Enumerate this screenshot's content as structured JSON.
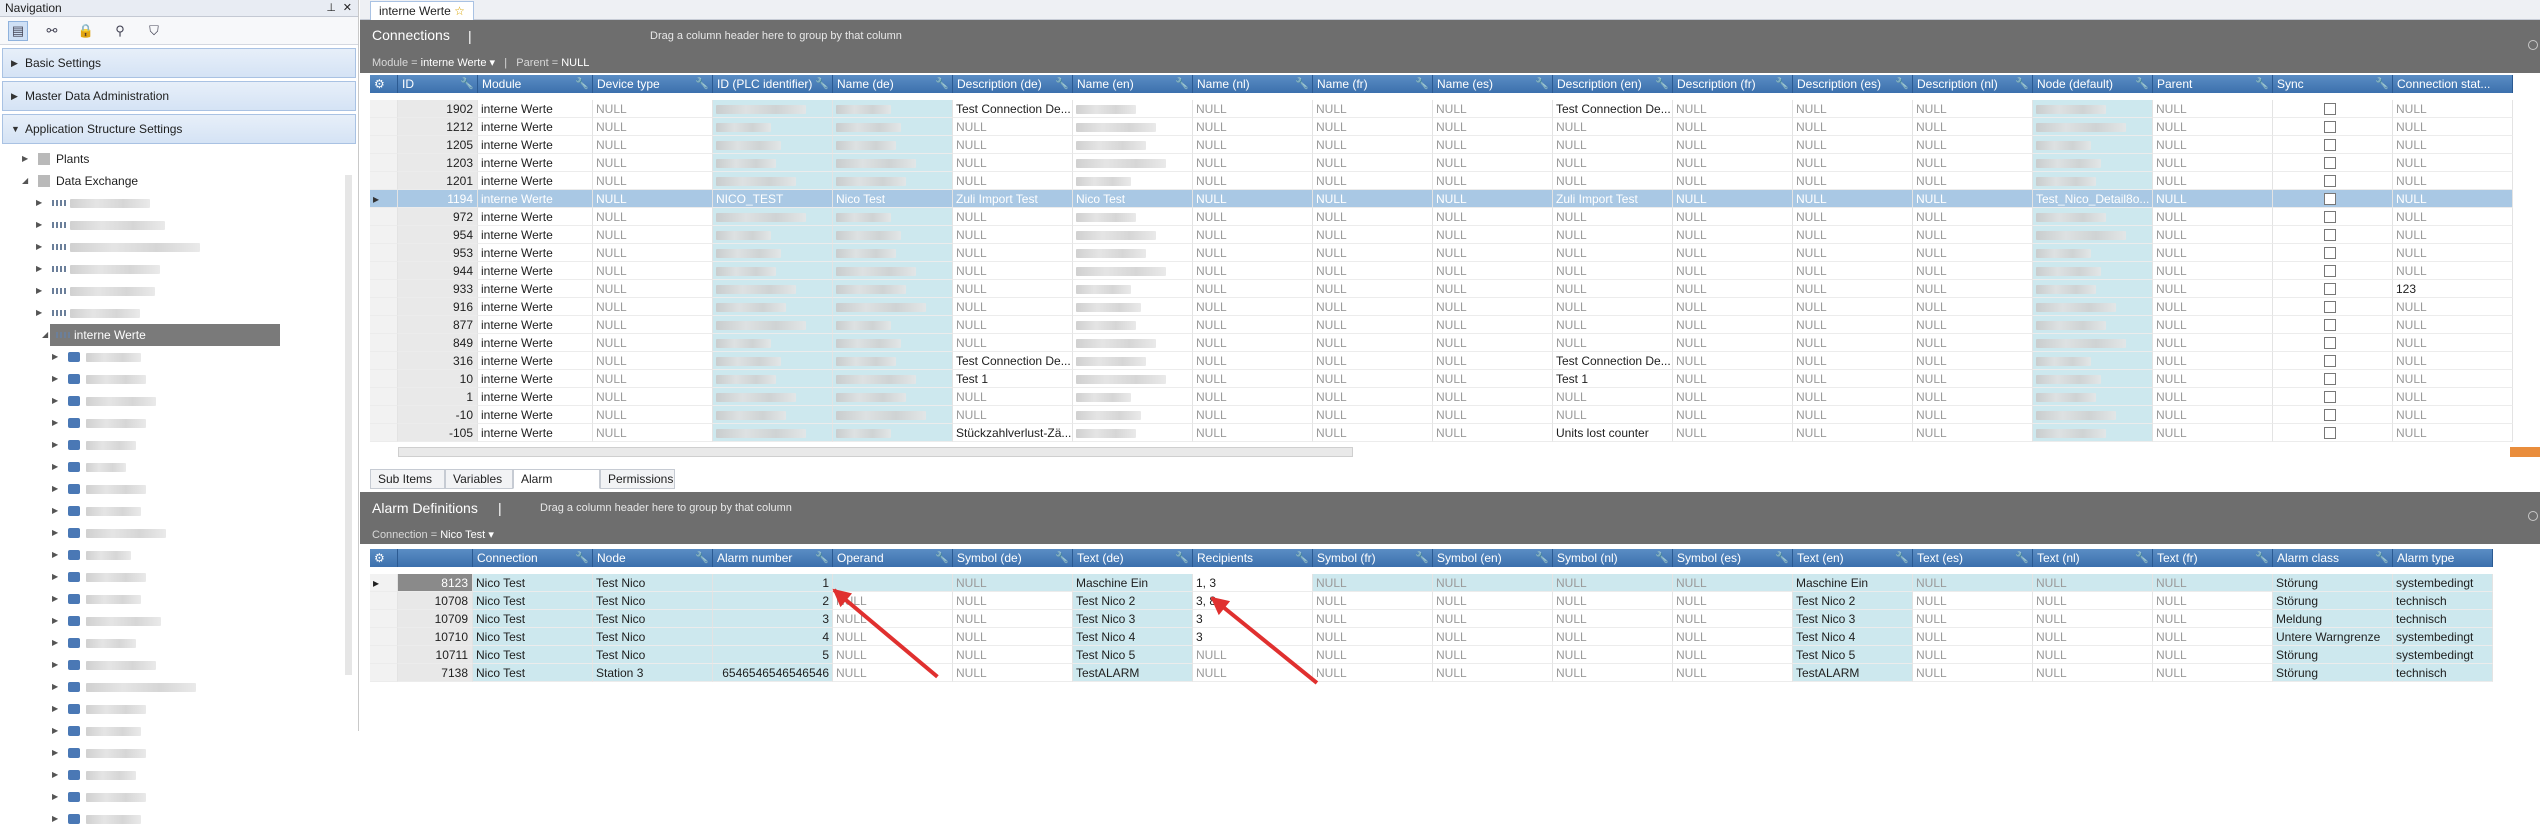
{
  "nav": {
    "title": "Navigation",
    "sections": [
      "Basic Settings",
      "Master Data Administration",
      "Application Structure Settings"
    ],
    "tree_top": [
      "Plants",
      "Data Exchange"
    ],
    "selected_node": "interne Werte"
  },
  "tab": {
    "label": "interne Werte"
  },
  "connections": {
    "title": "Connections",
    "group_hint": "Drag a column header here to group by that column",
    "filter_module_label": "Module =",
    "filter_module_value": "interne Werte",
    "filter_parent_label": "Parent =",
    "filter_parent_value": "NULL",
    "columns": [
      "ID",
      "Module",
      "Device type",
      "ID (PLC identifier)",
      "Name (de)",
      "Description (de)",
      "Name (en)",
      "Name (nl)",
      "Name (fr)",
      "Name (es)",
      "Description (en)",
      "Description (fr)",
      "Description (es)",
      "Description (nl)",
      "Node (default)",
      "Parent",
      "Sync",
      "Connection stat..."
    ],
    "rows": [
      {
        "id": "1902",
        "module": "interne Werte",
        "desc_de": "Test Connection De...",
        "desc_en": "Test Connection De..."
      },
      {
        "id": "1212",
        "module": "interne Werte",
        "desc_de": "NULL",
        "desc_en": "NULL"
      },
      {
        "id": "1205",
        "module": "interne Werte",
        "desc_de": "NULL",
        "desc_en": "NULL"
      },
      {
        "id": "1203",
        "module": "interne Werte",
        "desc_de": "NULL",
        "desc_en": "NULL"
      },
      {
        "id": "1201",
        "module": "interne Werte",
        "desc_de": "NULL",
        "desc_en": "NULL"
      },
      {
        "id": "1194",
        "module": "interne Werte",
        "plc": "NICO_TEST",
        "name_de": "Nico Test",
        "desc_de": "Zuli Import Test",
        "name_en": "Nico Test",
        "desc_en": "Zuli Import Test",
        "node": "Test_Nico_Detail8o...",
        "selected": true
      },
      {
        "id": "972",
        "module": "interne Werte",
        "desc_de": "NULL",
        "desc_en": "NULL"
      },
      {
        "id": "954",
        "module": "interne Werte",
        "desc_de": "NULL",
        "desc_en": "NULL"
      },
      {
        "id": "953",
        "module": "interne Werte",
        "desc_de": "NULL",
        "desc_en": "NULL"
      },
      {
        "id": "944",
        "module": "interne Werte",
        "desc_de": "NULL",
        "desc_en": "NULL"
      },
      {
        "id": "933",
        "module": "interne Werte",
        "desc_de": "NULL",
        "desc_en": "NULL",
        "conn": "123"
      },
      {
        "id": "916",
        "module": "interne Werte",
        "desc_de": "NULL",
        "desc_en": "NULL"
      },
      {
        "id": "877",
        "module": "interne Werte",
        "desc_de": "NULL",
        "desc_en": "NULL"
      },
      {
        "id": "849",
        "module": "interne Werte",
        "desc_de": "NULL",
        "desc_en": "NULL"
      },
      {
        "id": "316",
        "module": "interne Werte",
        "desc_de": "Test Connection De...",
        "desc_en": "Test Connection De..."
      },
      {
        "id": "10",
        "module": "interne Werte",
        "desc_de": "Test 1",
        "desc_en": "Test 1"
      },
      {
        "id": "1",
        "module": "interne Werte",
        "desc_de": "NULL",
        "desc_en": "NULL"
      },
      {
        "id": "-10",
        "module": "interne Werte",
        "desc_de": "NULL",
        "desc_en": "NULL"
      },
      {
        "id": "-105",
        "module": "interne Werte",
        "desc_de": "Stückzahlverlust-Zä...",
        "desc_en": "Units lost counter"
      }
    ],
    "null_text": "NULL"
  },
  "bottom_tabs": [
    "Sub Items",
    "Variables",
    "Alarm Definitions",
    "Permissions"
  ],
  "alarms": {
    "title": "Alarm Definitions",
    "group_hint": "Drag a column header here to group by that column",
    "filter_label": "Connection =",
    "filter_value": "Nico Test",
    "columns": [
      "Connection",
      "Node",
      "Alarm number",
      "Operand",
      "Symbol (de)",
      "Text (de)",
      "Recipients",
      "Symbol (fr)",
      "Symbol (en)",
      "Symbol (nl)",
      "Symbol (es)",
      "Text (en)",
      "Text (es)",
      "Text (nl)",
      "Text (fr)",
      "Alarm class",
      "Alarm type"
    ],
    "rows": [
      {
        "id": "8123",
        "conn": "Nico Test",
        "node": "Test Nico",
        "num": "1",
        "operand": "",
        "text_de": "Maschine Ein",
        "recipients": "1, 3",
        "text_en": "Maschine Ein",
        "aclass": "Störung",
        "atype": "systembedingt",
        "selected": true
      },
      {
        "id": "10708",
        "conn": "Nico Test",
        "node": "Test Nico",
        "num": "2",
        "operand": "NULL",
        "text_de": "Test Nico 2",
        "recipients": "3, 8",
        "text_en": "Test Nico 2",
        "aclass": "Störung",
        "atype": "technisch"
      },
      {
        "id": "10709",
        "conn": "Nico Test",
        "node": "Test Nico",
        "num": "3",
        "operand": "NULL",
        "text_de": "Test Nico 3",
        "recipients": "3",
        "text_en": "Test Nico 3",
        "aclass": "Meldung",
        "atype": "technisch"
      },
      {
        "id": "10710",
        "conn": "Nico Test",
        "node": "Test Nico",
        "num": "4",
        "operand": "NULL",
        "text_de": "Test Nico 4",
        "recipients": "3",
        "text_en": "Test Nico 4",
        "aclass": "Untere Warngrenze",
        "atype": "systembedingt"
      },
      {
        "id": "10711",
        "conn": "Nico Test",
        "node": "Test Nico",
        "num": "5",
        "operand": "NULL",
        "text_de": "Test Nico 5",
        "recipients": "NULL",
        "text_en": "Test Nico 5",
        "aclass": "Störung",
        "atype": "systembedingt"
      },
      {
        "id": "7138",
        "conn": "Nico Test",
        "node": "Station 3",
        "num": "6546546546546546",
        "operand": "NULL",
        "text_de": "TestALARM",
        "recipients": "NULL",
        "text_en": "TestALARM",
        "aclass": "Störung",
        "atype": "technisch"
      }
    ]
  }
}
